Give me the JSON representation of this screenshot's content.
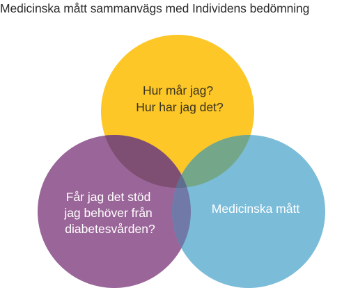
{
  "title": "Medicinska mått sammanvägs med Individens bedömning",
  "circles": {
    "top": {
      "lines": [
        "Hur mår jag?",
        "Hur har jag det?"
      ],
      "fill": "#fdc727",
      "text_color": "#3a3320"
    },
    "left": {
      "lines": [
        "Får jag det stöd",
        "jag behöver från",
        "diabetesvården?"
      ],
      "fill": "#9a6598",
      "text_color": "#ffffff"
    },
    "right": {
      "lines": [
        "Medicinska mått"
      ],
      "fill": "#7bbcd9",
      "text_color": "#ffffff"
    }
  },
  "overlap_colors": {
    "top_left": "#7e4f73",
    "top_right": "#74a78a",
    "left_right": "#7079a8",
    "center": "#5f6d8f"
  }
}
